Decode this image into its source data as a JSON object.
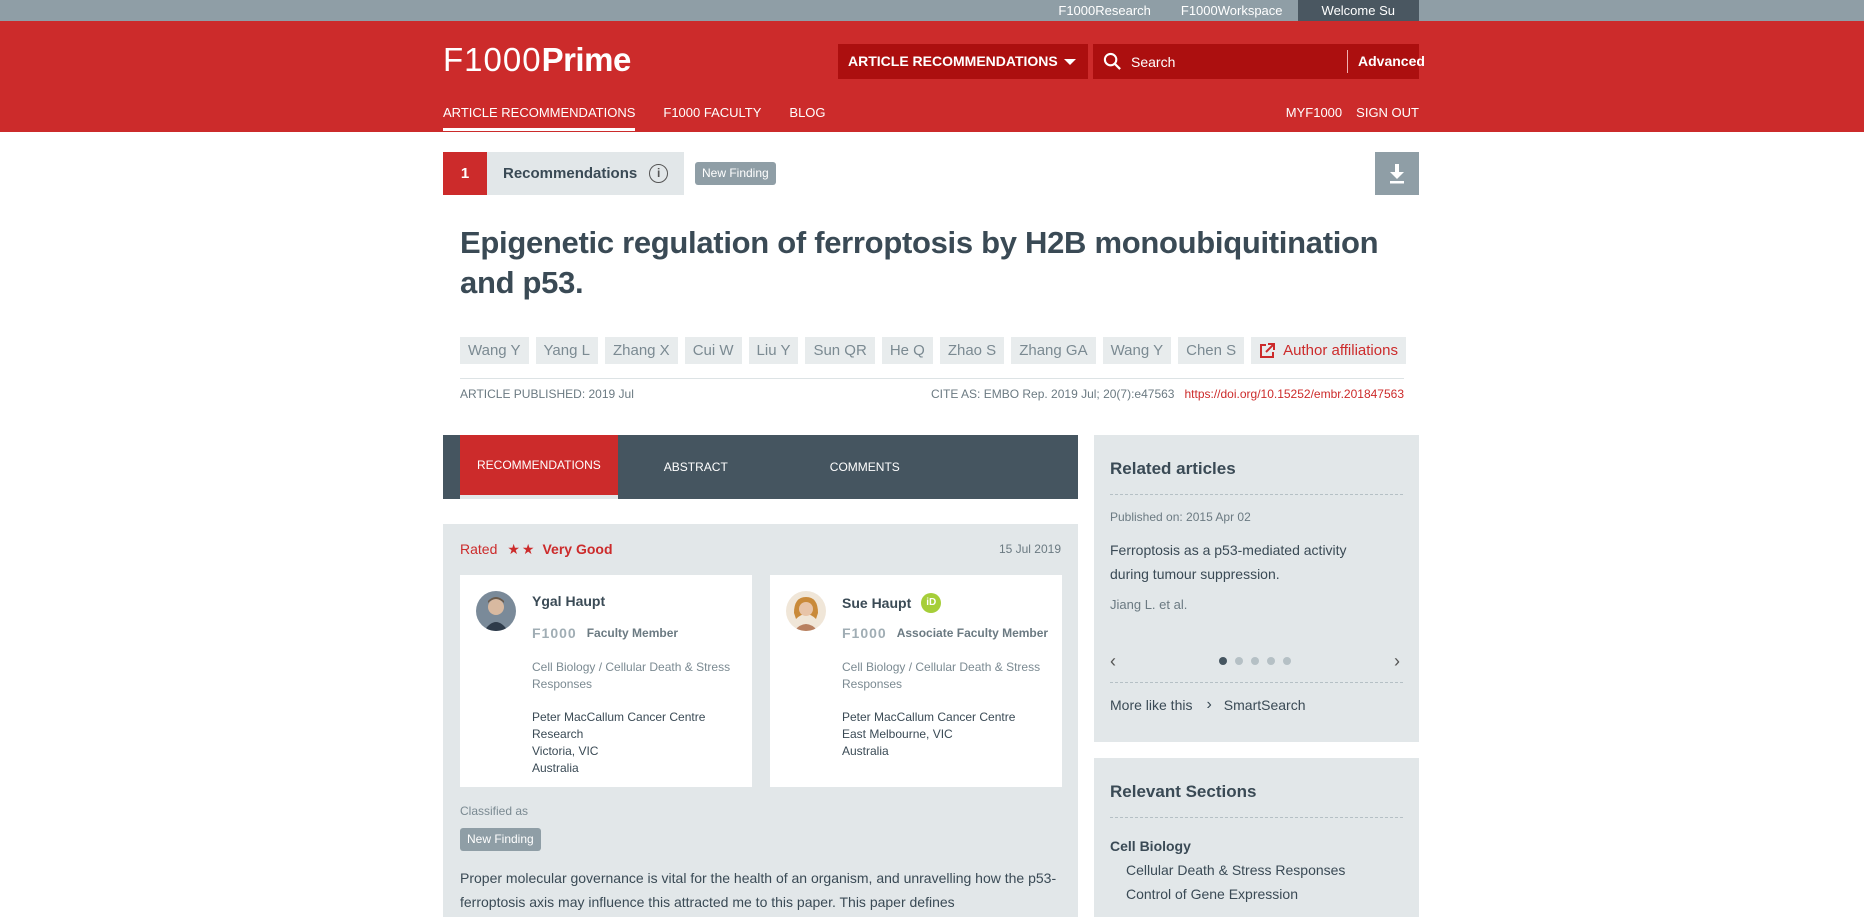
{
  "topbar": {
    "links": [
      "F1000Research",
      "F1000Workspace"
    ],
    "welcome": "Welcome Su"
  },
  "header": {
    "logo_f": "F1000",
    "logo_p": "Prime",
    "category_select": "ARTICLE RECOMMENDATIONS",
    "search_placeholder": "Search",
    "advanced": "Advanced",
    "nav": [
      "ARTICLE RECOMMENDATIONS",
      "F1000 FACULTY",
      "BLOG"
    ],
    "nav_right": [
      "MYF1000",
      "SIGN OUT"
    ]
  },
  "article": {
    "rec_count": "1",
    "rec_label": "Recommendations",
    "badge": "New Finding",
    "title": "Epigenetic regulation of ferroptosis by H2B monoubiquitination and p53.",
    "authors": [
      "Wang Y",
      "Yang L",
      "Zhang X",
      "Cui W",
      "Liu Y",
      "Sun QR",
      "He Q",
      "Zhao S",
      "Zhang GA",
      "Wang Y",
      "Chen S"
    ],
    "affiliations_link": "Author affiliations",
    "published": "ARTICLE PUBLISHED: 2019 Jul",
    "cite": "CITE AS: EMBO Rep. 2019 Jul; 20(7):e47563",
    "doi": "https://doi.org/10.15252/embr.201847563"
  },
  "tabs": [
    "RECOMMENDATIONS",
    "ABSTRACT",
    "COMMENTS"
  ],
  "recommendation": {
    "rated_label": "Rated",
    "stars": "★★",
    "rating": "Very Good",
    "date": "15 Jul 2019",
    "reviewers": [
      {
        "name": "Ygal Haupt",
        "logo": "F1000",
        "role": "Faculty Member",
        "section": "Cell Biology / Cellular Death & Stress Responses",
        "address": [
          "Peter MacCallum Cancer Centre",
          "Research",
          "Victoria, VIC",
          "Australia"
        ]
      },
      {
        "name": "Sue Haupt",
        "orcid": "iD",
        "logo": "F1000",
        "role": "Associate Faculty Member",
        "section": "Cell Biology / Cellular Death & Stress Responses",
        "address": [
          "Peter MacCallum Cancer Centre",
          "East Melbourne, VIC",
          "Australia"
        ]
      }
    ],
    "classified_label": "Classified as",
    "classified_badge": "New Finding",
    "text": "Proper molecular governance is vital for the health of an organism, and unravelling how the p53-ferroptosis axis may influence this attracted me to this paper. This paper defines"
  },
  "related": {
    "heading": "Related articles",
    "published_on": "Published on: 2015 Apr 02",
    "title": "Ferroptosis as a p53-mediated activity during tumour suppression.",
    "authors": "Jiang L. et al.",
    "pager_total": 5,
    "pager_active": 1,
    "more_like": "More like this",
    "smartsearch": "SmartSearch"
  },
  "relevant": {
    "heading": "Relevant Sections",
    "category": "Cell Biology",
    "subsections": [
      "Cellular Death & Stress Responses",
      "Control of Gene Expression"
    ]
  },
  "colors": {
    "brand_red": "#cc2b2b",
    "dark_red": "#ac0f0f",
    "slate": "#455560",
    "panel": "#e2e7e9",
    "topbar": "#8f9ea6"
  }
}
